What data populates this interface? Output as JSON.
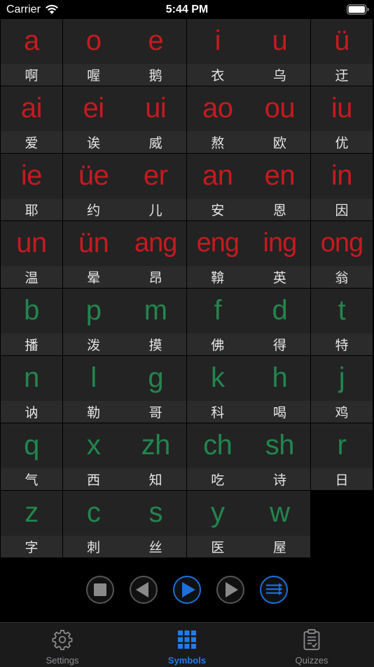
{
  "status": {
    "carrier": "Carrier",
    "time": "5:44 PM"
  },
  "rows": [
    [
      {
        "sym": "a",
        "char": "啊",
        "kind": "final"
      },
      {
        "sym": "o",
        "char": "喔",
        "kind": "final"
      },
      {
        "sym": "e",
        "char": "鹅",
        "kind": "final"
      },
      {
        "sym": "i",
        "char": "衣",
        "kind": "final"
      },
      {
        "sym": "u",
        "char": "乌",
        "kind": "final"
      },
      {
        "sym": "ü",
        "char": "迂",
        "kind": "final"
      }
    ],
    [
      {
        "sym": "ai",
        "char": "爱",
        "kind": "final"
      },
      {
        "sym": "ei",
        "char": "诶",
        "kind": "final"
      },
      {
        "sym": "ui",
        "char": "威",
        "kind": "final"
      },
      {
        "sym": "ao",
        "char": "熬",
        "kind": "final"
      },
      {
        "sym": "ou",
        "char": "欧",
        "kind": "final"
      },
      {
        "sym": "iu",
        "char": "优",
        "kind": "final"
      }
    ],
    [
      {
        "sym": "ie",
        "char": "耶",
        "kind": "final"
      },
      {
        "sym": "üe",
        "char": "约",
        "kind": "final"
      },
      {
        "sym": "er",
        "char": "儿",
        "kind": "final"
      },
      {
        "sym": "an",
        "char": "安",
        "kind": "final"
      },
      {
        "sym": "en",
        "char": "恩",
        "kind": "final"
      },
      {
        "sym": "in",
        "char": "因",
        "kind": "final"
      }
    ],
    [
      {
        "sym": "un",
        "char": "温",
        "kind": "final"
      },
      {
        "sym": "ün",
        "char": "晕",
        "kind": "final"
      },
      {
        "sym": "ang",
        "char": "昂",
        "kind": "final"
      },
      {
        "sym": "eng",
        "char": "鞥",
        "kind": "final"
      },
      {
        "sym": "ing",
        "char": "英",
        "kind": "final"
      },
      {
        "sym": "ong",
        "char": "翁",
        "kind": "final"
      }
    ],
    [
      {
        "sym": "b",
        "char": "播",
        "kind": "initial"
      },
      {
        "sym": "p",
        "char": "泼",
        "kind": "initial"
      },
      {
        "sym": "m",
        "char": "摸",
        "kind": "initial"
      },
      {
        "sym": "f",
        "char": "佛",
        "kind": "initial"
      },
      {
        "sym": "d",
        "char": "得",
        "kind": "initial"
      },
      {
        "sym": "t",
        "char": "特",
        "kind": "initial"
      }
    ],
    [
      {
        "sym": "n",
        "char": "讷",
        "kind": "initial"
      },
      {
        "sym": "l",
        "char": "勒",
        "kind": "initial"
      },
      {
        "sym": "g",
        "char": "哥",
        "kind": "initial"
      },
      {
        "sym": "k",
        "char": "科",
        "kind": "initial"
      },
      {
        "sym": "h",
        "char": "喝",
        "kind": "initial"
      },
      {
        "sym": "j",
        "char": "鸡",
        "kind": "initial"
      }
    ],
    [
      {
        "sym": "q",
        "char": "气",
        "kind": "initial"
      },
      {
        "sym": "x",
        "char": "西",
        "kind": "initial"
      },
      {
        "sym": "zh",
        "char": "知",
        "kind": "initial"
      },
      {
        "sym": "ch",
        "char": "吃",
        "kind": "initial"
      },
      {
        "sym": "sh",
        "char": "诗",
        "kind": "initial"
      },
      {
        "sym": "r",
        "char": "日",
        "kind": "initial"
      }
    ],
    [
      {
        "sym": "z",
        "char": "字",
        "kind": "initial"
      },
      {
        "sym": "c",
        "char": "刺",
        "kind": "initial"
      },
      {
        "sym": "s",
        "char": "丝",
        "kind": "initial"
      },
      {
        "sym": "y",
        "char": "医",
        "kind": "initial"
      },
      {
        "sym": "w",
        "char": "屋",
        "kind": "initial"
      }
    ]
  ],
  "controls": [
    {
      "name": "stop-button",
      "icon": "stop-icon"
    },
    {
      "name": "previous-button",
      "icon": "previous-icon"
    },
    {
      "name": "play-button",
      "icon": "play-icon"
    },
    {
      "name": "next-button",
      "icon": "next-icon"
    },
    {
      "name": "playlist-button",
      "icon": "playlist-icon"
    }
  ],
  "tabs": [
    {
      "label": "Settings",
      "icon": "gear-icon",
      "active": false
    },
    {
      "label": "Symbols",
      "icon": "grid-icon",
      "active": true
    },
    {
      "label": "Quizzes",
      "icon": "clipboard-icon",
      "active": false
    }
  ],
  "colors": {
    "final": "#c61a20",
    "initial": "#23854f",
    "accent": "#1e7cf0"
  }
}
